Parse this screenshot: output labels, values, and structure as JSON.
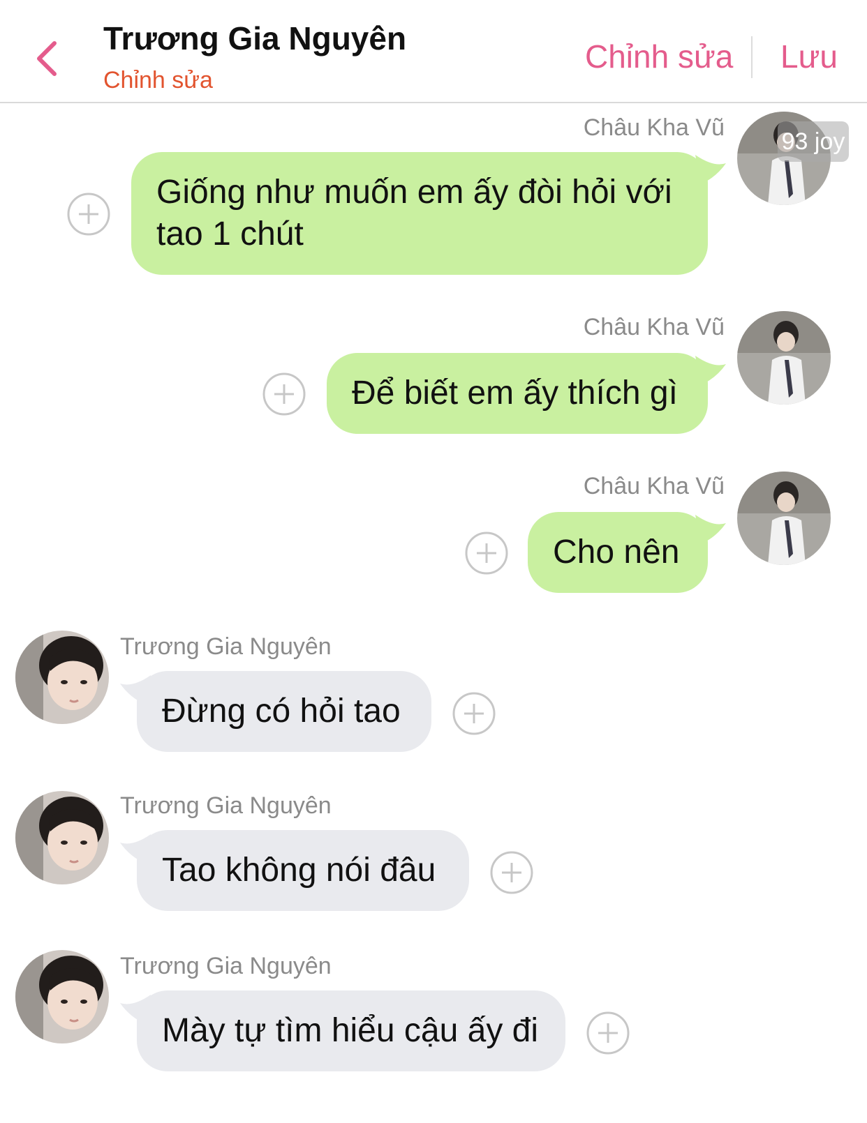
{
  "header": {
    "title": "Trương Gia Nguyên",
    "subtitle": "Chỉnh sửa",
    "edit_label": "Chỉnh sửa",
    "save_label": "Lưu"
  },
  "watermark": "93 joy",
  "messages": [
    {
      "sender": "Châu Kha Vũ",
      "text": "Giống như muốn em ấy đòi hỏi với tao 1 chút",
      "side": "right"
    },
    {
      "sender": "Châu Kha Vũ",
      "text": "Để biết em ấy thích gì",
      "side": "right"
    },
    {
      "sender": "Châu Kha Vũ",
      "text": "Cho nên",
      "side": "right"
    },
    {
      "sender": "Trương Gia Nguyên",
      "text": "Đừng có hỏi tao",
      "side": "left"
    },
    {
      "sender": "Trương Gia Nguyên",
      "text": "Tao không nói đâu",
      "side": "left"
    },
    {
      "sender": "Trương Gia Nguyên",
      "text": "Mày tự tìm hiểu cậu ấy đi",
      "side": "left"
    }
  ],
  "colors": {
    "accent": "#e45c8c",
    "subtitle": "#e2542f",
    "sent_bubble": "#c9f0a0",
    "received_bubble": "#e9eaee"
  },
  "icons": {
    "back": "chevron-left-icon",
    "add": "plus-circle-icon"
  }
}
